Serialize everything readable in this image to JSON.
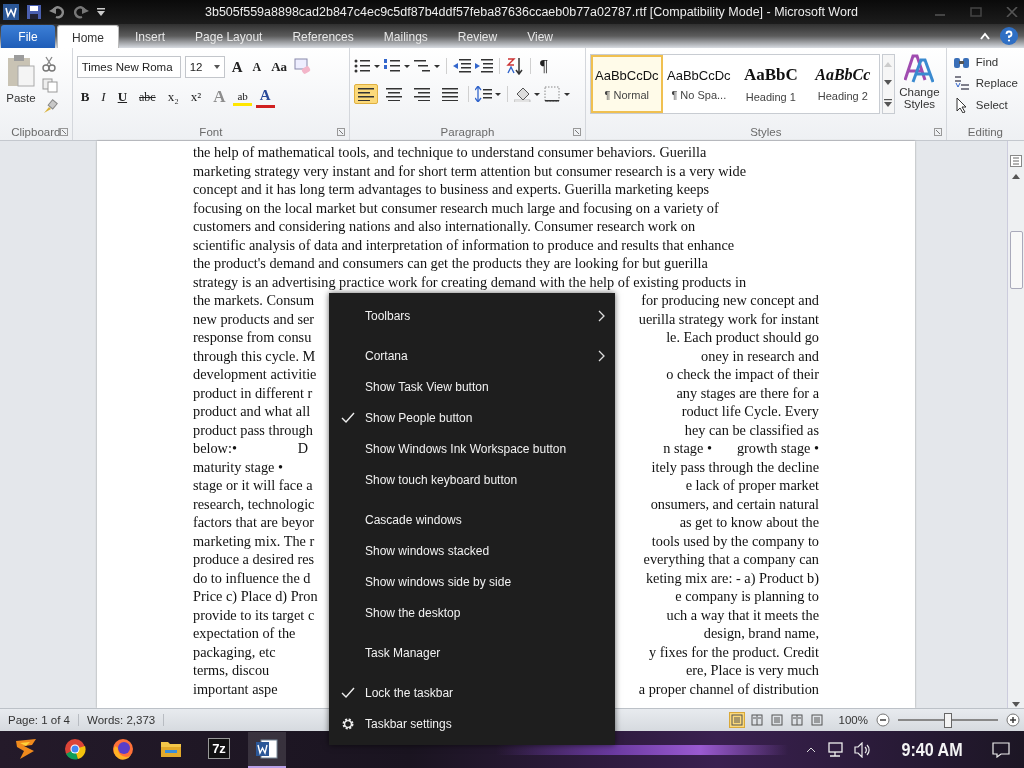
{
  "window": {
    "title": "3b505f559a8898cad2b847c4ec9c5df87b4ddf57feba87636ccaeb0b77a02787.rtf [Compatibility Mode] - Microsoft Word"
  },
  "tabs": [
    {
      "label": "File",
      "kind": "file",
      "selected": false
    },
    {
      "label": "Home",
      "kind": "tab",
      "selected": true
    },
    {
      "label": "Insert",
      "kind": "tab",
      "selected": false
    },
    {
      "label": "Page Layout",
      "kind": "tab",
      "selected": false
    },
    {
      "label": "References",
      "kind": "tab",
      "selected": false
    },
    {
      "label": "Mailings",
      "kind": "tab",
      "selected": false
    },
    {
      "label": "Review",
      "kind": "tab",
      "selected": false
    },
    {
      "label": "View",
      "kind": "tab",
      "selected": false
    }
  ],
  "ribbon": {
    "clipboard": {
      "paste_label": "Paste",
      "group_label": "Clipboard"
    },
    "font": {
      "font_name": "Times New Roma",
      "font_size": "12",
      "case_label": "Aa",
      "grow_label": "A",
      "shrink_label": "A",
      "format_buttons": [
        {
          "label": "B",
          "kind": "bold"
        },
        {
          "label": "I",
          "kind": "italic"
        },
        {
          "label": "U",
          "kind": "underline"
        },
        {
          "label": "abc",
          "kind": "strike"
        },
        {
          "label": "x₂",
          "kind": "plain"
        },
        {
          "label": "x²",
          "kind": "plain"
        }
      ],
      "effects_label": "A",
      "highlight_label": "ab",
      "color_label": "A",
      "group_label": "Font"
    },
    "paragraph": {
      "pilcrow": "¶",
      "alignment": [
        {
          "selected": true
        },
        {
          "selected": false
        },
        {
          "selected": false
        },
        {
          "selected": false
        }
      ],
      "group_label": "Paragraph"
    },
    "styles": {
      "items": [
        {
          "sample": "AaBbCcDc",
          "name": "¶ Normal",
          "kind": "plain",
          "selected": true
        },
        {
          "sample": "AaBbCcDc",
          "name": "¶ No Spa...",
          "kind": "plain",
          "selected": false
        },
        {
          "sample": "AaBbC",
          "name": "Heading 1",
          "kind": "heading1",
          "selected": false
        },
        {
          "sample": "AaBbCc",
          "name": "Heading 2",
          "kind": "heading2",
          "selected": false
        }
      ],
      "change_label": "Change Styles",
      "group_label": "Styles"
    },
    "editing": {
      "items": [
        {
          "label": "Find",
          "kind": "find"
        },
        {
          "label": "Replace",
          "kind": "replace"
        },
        {
          "label": "Select",
          "kind": "select"
        }
      ],
      "group_label": "Editing"
    }
  },
  "document": {
    "lines": [
      {
        "text": "the help of mathematical tools, and technique to understand consumer behaviors. Guerilla"
      },
      {
        "text": "marketing strategy very instant and for short term attention but consumer research is a very wide"
      },
      {
        "text": "concept and it has long term advantages to business and experts. Guerilla marketing keeps"
      },
      {
        "text": "focusing on the local market but consumer research much large and focusing on a variety of"
      },
      {
        "text": "customers and considering nations and also internationally. Consumer research work on"
      },
      {
        "text": "scientific analysis of data and interpretation of information to produce and results that enhance"
      },
      {
        "text": "the product's demand and consumers can get the products they are looking for but guerilla"
      },
      {
        "text": "strategy is an advertising practice work for creating demand with the help of existing products in"
      },
      {
        "left": "the markets. Consum",
        "right": "for producing new concept and"
      },
      {
        "left": "new products and ser",
        "right": "uerilla strategy work for instant"
      },
      {
        "left": "response from consu",
        "right": "le. Each product should go"
      },
      {
        "left": "through this cycle. M",
        "right": "oney in research and"
      },
      {
        "left": "development activitie",
        "right": "o check the impact of their"
      },
      {
        "left": "product in different r",
        "right": "any stages are there for a"
      },
      {
        "left": "product and what all",
        "right": "roduct life Cycle. Every"
      },
      {
        "left": "product pass through",
        "right": "hey can be classified as"
      },
      {
        "left": "below:•                 D",
        "right": "n stage •       growth stage •"
      },
      {
        "left": "maturity stage •",
        "right": "itely pass through the decline"
      },
      {
        "left": "stage or it will face a",
        "right": "e lack of proper market"
      },
      {
        "left": "research, technologic",
        "right": "onsumers, and certain natural"
      },
      {
        "left": "factors that are beyor",
        "right": "as get to know about the"
      },
      {
        "left": "marketing mix. The r",
        "right": "tools used by the company to"
      },
      {
        "left": "produce a desired res",
        "right": "everything that a company can"
      },
      {
        "left": "do to influence the d",
        "right": "keting mix are: - a) Product b)"
      },
      {
        "left": "Price c) Place d) Pron",
        "right": "e company is planning to"
      },
      {
        "left": "provide to its target c",
        "right": "uch a way that it meets the"
      },
      {
        "left": "expectation of the",
        "right": "design, brand name,"
      },
      {
        "left": "packaging, etc",
        "right": "y fixes for the product. Credit"
      },
      {
        "left": "terms, discou",
        "right": "ere, Place is very much"
      },
      {
        "left": "important aspe",
        "right": "a proper channel of distribution"
      }
    ]
  },
  "status_bar": {
    "page": "Page: 1 of 4",
    "words": "Words: 2,373",
    "views": [
      {
        "selected": true
      },
      {
        "selected": false
      },
      {
        "selected": false
      },
      {
        "selected": false
      },
      {
        "selected": false
      }
    ],
    "zoom": "100%",
    "zoom_slider": {
      "level": 0.5
    }
  },
  "context_menu": {
    "groups": [
      {
        "items": [
          {
            "label": "Toolbars",
            "kind": "submenu"
          }
        ]
      },
      {
        "items": [
          {
            "label": "Cortana",
            "kind": "submenu"
          },
          {
            "label": "Show Task View button",
            "kind": "toggle",
            "checked": false
          },
          {
            "label": "Show People button",
            "kind": "toggle",
            "checked": true
          },
          {
            "label": "Show Windows Ink Workspace button",
            "kind": "toggle",
            "checked": false
          },
          {
            "label": "Show touch keyboard button",
            "kind": "toggle",
            "checked": false
          }
        ]
      },
      {
        "items": [
          {
            "label": "Cascade windows",
            "kind": "command"
          },
          {
            "label": "Show windows stacked",
            "kind": "command"
          },
          {
            "label": "Show windows side by side",
            "kind": "command"
          },
          {
            "label": "Show the desktop",
            "kind": "command"
          }
        ]
      },
      {
        "items": [
          {
            "label": "Task Manager",
            "kind": "command"
          }
        ]
      },
      {
        "items": [
          {
            "label": "Lock the taskbar",
            "kind": "toggle",
            "checked": true
          },
          {
            "label": "Taskbar settings",
            "kind": "settings"
          }
        ]
      }
    ]
  },
  "taskbar": {
    "apps": [
      {
        "kind": "start",
        "selected": false
      },
      {
        "kind": "chrome",
        "selected": false
      },
      {
        "kind": "firefox",
        "selected": false
      },
      {
        "kind": "folder",
        "selected": false
      },
      {
        "kind": "sevenzip",
        "label": "7z",
        "selected": false
      },
      {
        "kind": "word",
        "selected": true
      }
    ],
    "time": "9:40 AM"
  }
}
